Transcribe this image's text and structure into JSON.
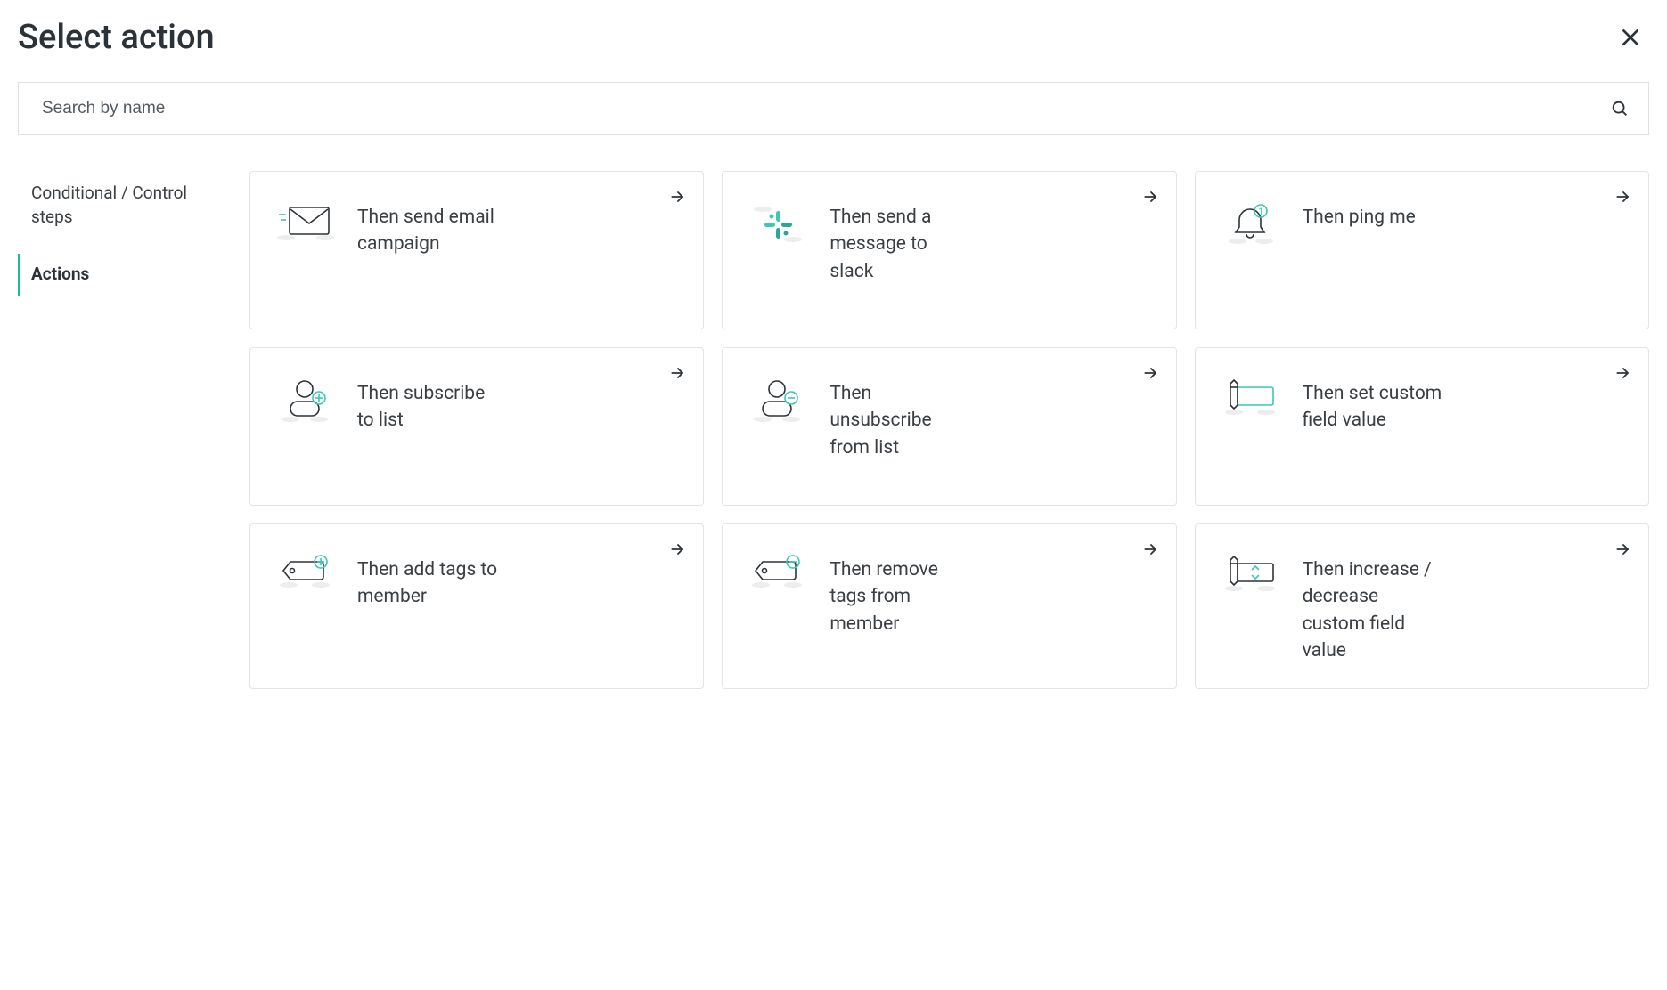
{
  "header": {
    "title": "Select action"
  },
  "search": {
    "placeholder": "Search by name",
    "value": ""
  },
  "sidebar": {
    "items": [
      {
        "label": "Conditional / Control steps",
        "active": false
      },
      {
        "label": "Actions",
        "active": true
      }
    ]
  },
  "cards": [
    {
      "icon": "email-icon",
      "label": "Then send email campaign"
    },
    {
      "icon": "slack-icon",
      "label": "Then send a message to slack"
    },
    {
      "icon": "bell-icon",
      "label": "Then ping me"
    },
    {
      "icon": "subscribe-icon",
      "label": "Then subscribe to list"
    },
    {
      "icon": "unsubscribe-icon",
      "label": "Then unsubscribe from list"
    },
    {
      "icon": "field-edit-icon",
      "label": "Then set custom field value"
    },
    {
      "icon": "tag-add-icon",
      "label": "Then add tags to member"
    },
    {
      "icon": "tag-remove-icon",
      "label": "Then remove tags from member"
    },
    {
      "icon": "field-updown-icon",
      "label": "Then increase / decrease custom field value"
    }
  ],
  "colors": {
    "accent": "#1abc9c",
    "stroke": "#2c3338",
    "shadow": "#e6e6e6"
  }
}
